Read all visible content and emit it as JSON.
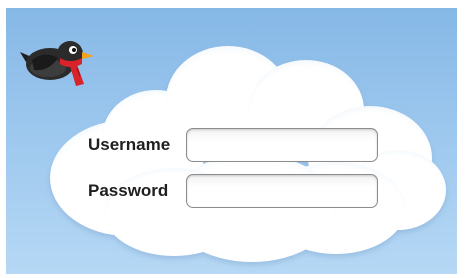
{
  "login_form": {
    "username_label": "Username",
    "username_value": "",
    "password_label": "Password",
    "password_value": ""
  },
  "mascot": {
    "icon": "bird-with-red-scarf-icon"
  },
  "colors": {
    "sky_top": "#86b8e6",
    "sky_bottom": "#b6d8f5",
    "cloud": "#ffffff",
    "scarf": "#d8232a",
    "bird_body": "#2b2b2b",
    "beak": "#f2a21b"
  }
}
